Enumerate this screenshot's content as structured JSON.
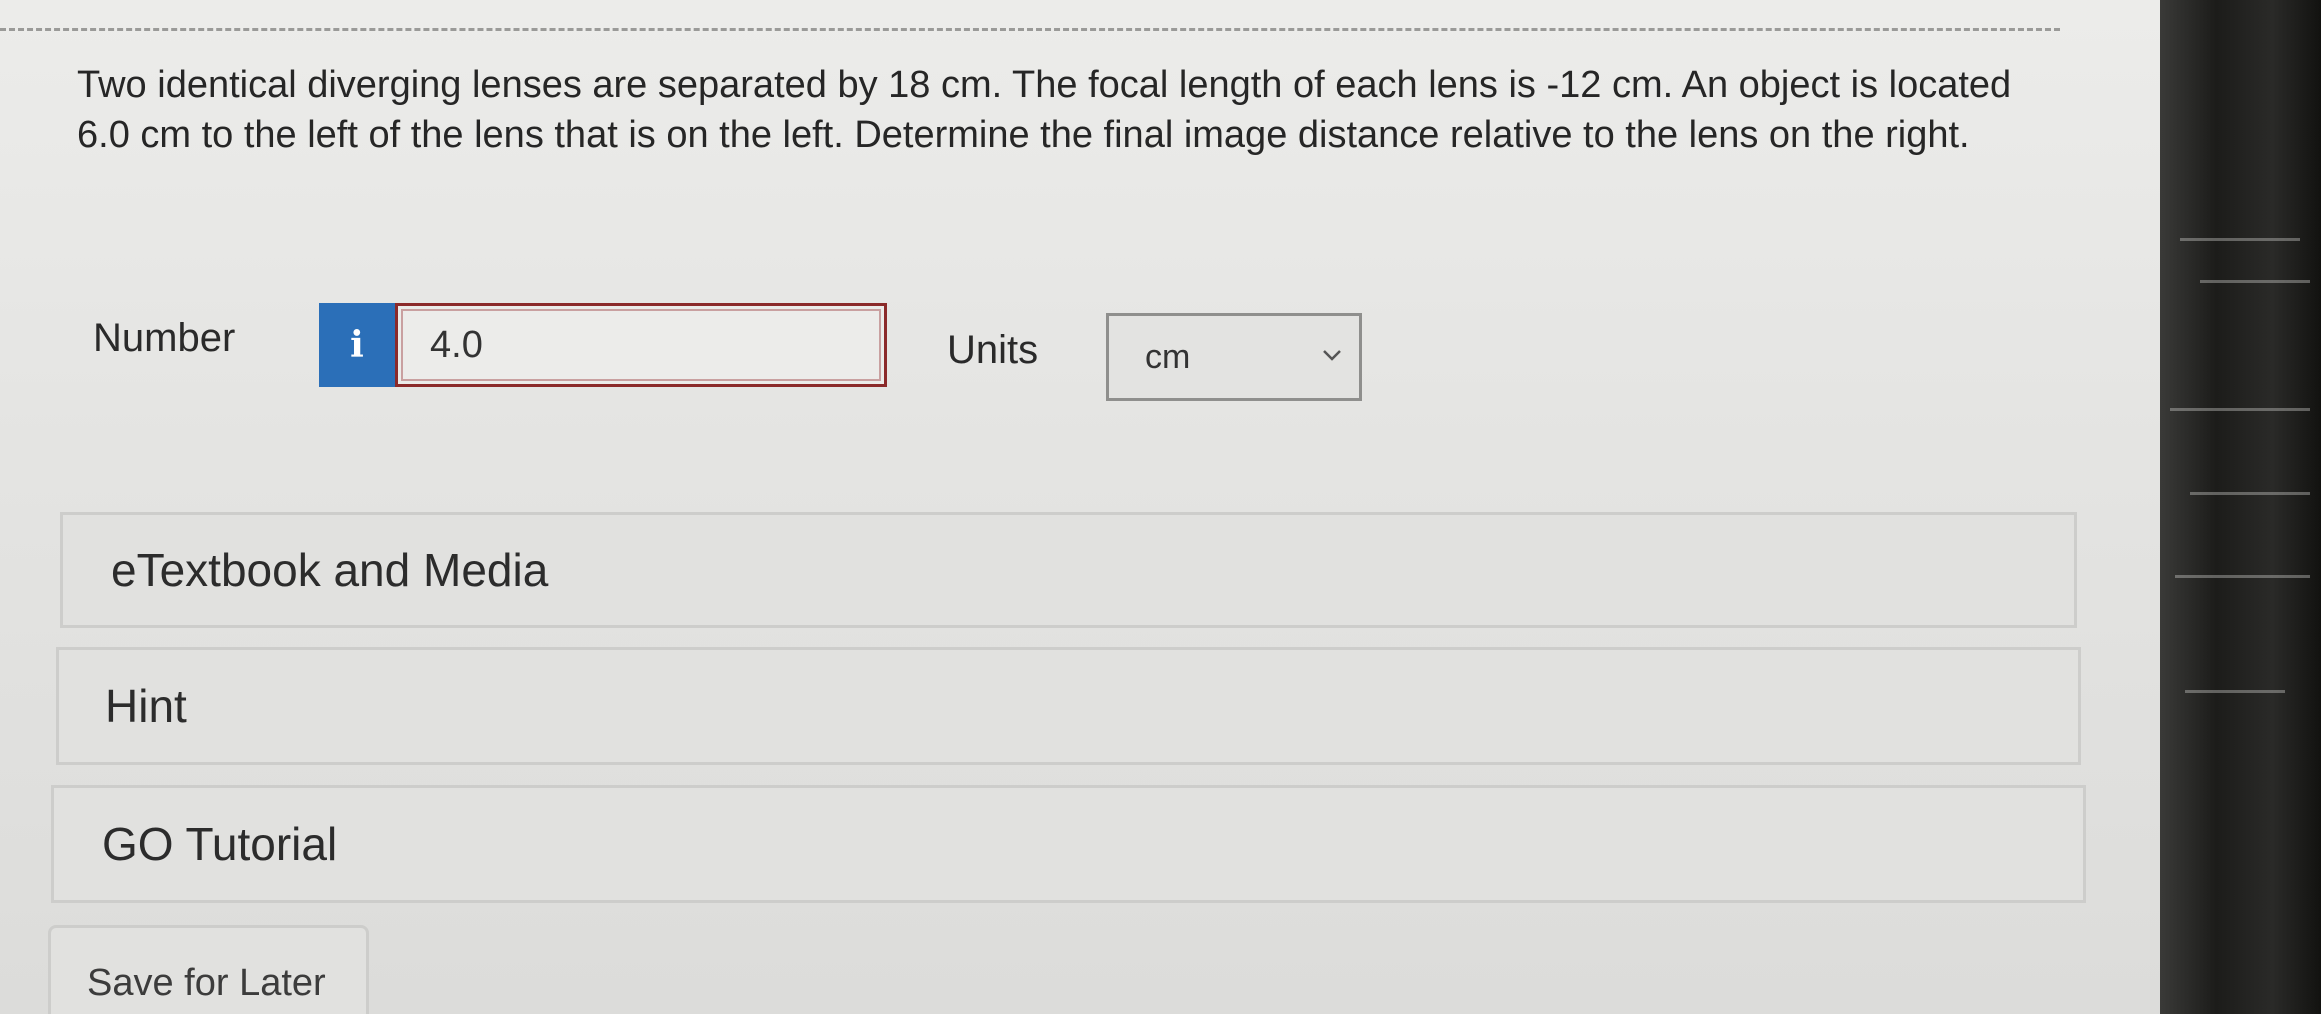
{
  "question": {
    "text": "Two identical diverging lenses are separated by 18 cm. The focal length of each lens is -12 cm. An object is located 6.0 cm to the left of the lens that is on the left. Determine the final image distance relative to the lens on the right."
  },
  "answer": {
    "number_label": "Number",
    "info_glyph": "i",
    "number_value": "4.0",
    "units_label": "Units",
    "units_selected": "cm"
  },
  "panels": {
    "etextbook_label": "eTextbook and Media",
    "hint_label": "Hint",
    "tutorial_label": "GO Tutorial"
  },
  "actions": {
    "save_label": "Save for Later"
  },
  "colors": {
    "info_button": "#2b6fb8",
    "input_border": "#8b2a2a"
  },
  "icons": {
    "info": "info-icon",
    "units_dropdown": "chevron-down-icon"
  }
}
